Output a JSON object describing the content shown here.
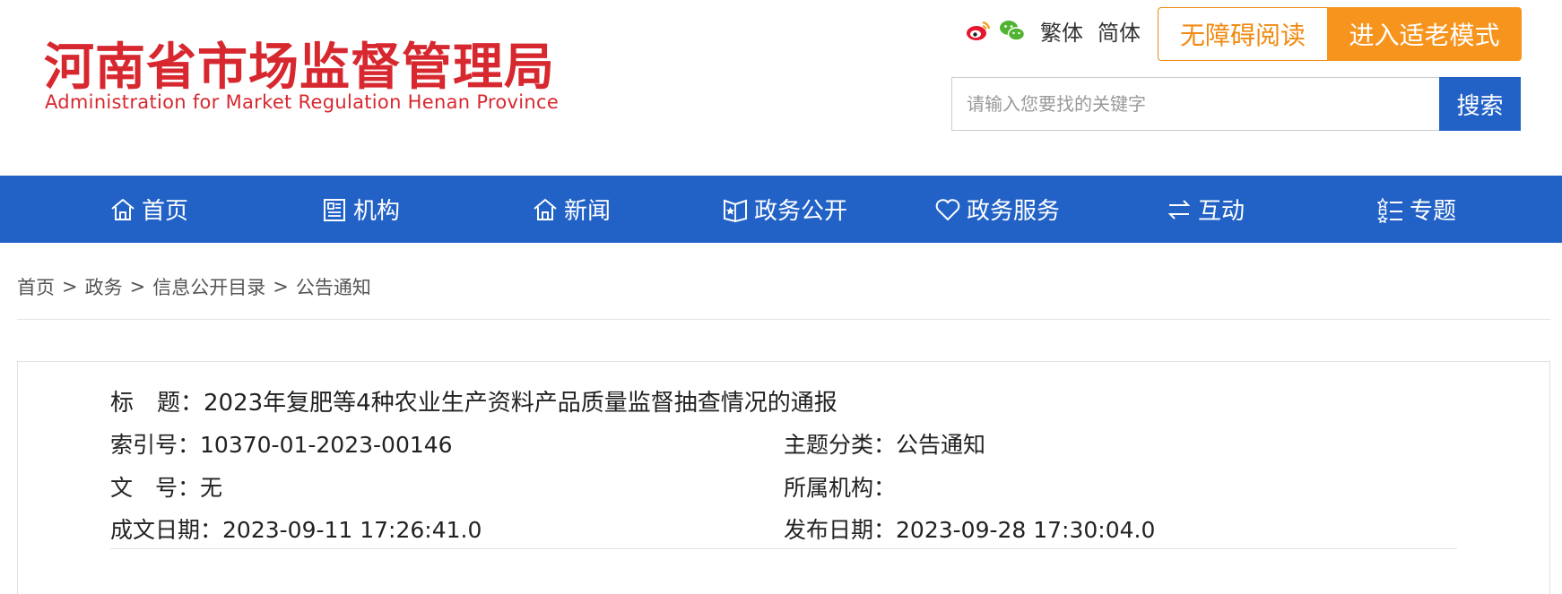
{
  "header": {
    "logo_cn": "河南省市场监督管理局",
    "logo_en": "Administration for Market Regulation Henan Province",
    "social": [
      "weibo-icon",
      "wechat-icon"
    ],
    "lang_traditional": "繁体",
    "lang_simplified": "简体",
    "accessibility_label": "无障碍阅读",
    "elder_mode_label": "进入适老模式",
    "search_placeholder": "请输入您要找的关键字",
    "search_button": "搜索",
    "colors": {
      "brand_red": "#d7282f",
      "accent_orange": "#f7941d",
      "nav_blue": "#2262c6"
    }
  },
  "nav": {
    "items": [
      {
        "label": "首页",
        "icon": "home-icon"
      },
      {
        "label": "机构",
        "icon": "org-icon"
      },
      {
        "label": "新闻",
        "icon": "news-icon"
      },
      {
        "label": "政务公开",
        "icon": "open-gov-icon"
      },
      {
        "label": "政务服务",
        "icon": "heart-icon"
      },
      {
        "label": "互动",
        "icon": "exchange-icon"
      },
      {
        "label": "专题",
        "icon": "topic-icon"
      }
    ]
  },
  "breadcrumb": {
    "items": [
      "首页",
      "政务",
      "信息公开目录",
      "公告通知"
    ],
    "separator": ">"
  },
  "document": {
    "title_label": "标　题：",
    "title_value": "2023年复肥等4种农业生产资料产品质量监督抽查情况的通报",
    "index_label": "索引号：",
    "index_value": "10370-01-2023-00146",
    "category_label": "主题分类：",
    "category_value": "公告通知",
    "doc_no_label": "文　号：",
    "doc_no_value": "无",
    "org_label": "所属机构：",
    "org_value": "",
    "created_label": "成文日期：",
    "created_value": "2023-09-11 17:26:41.0",
    "published_label": "发布日期：",
    "published_value": "2023-09-28 17:30:04.0"
  }
}
